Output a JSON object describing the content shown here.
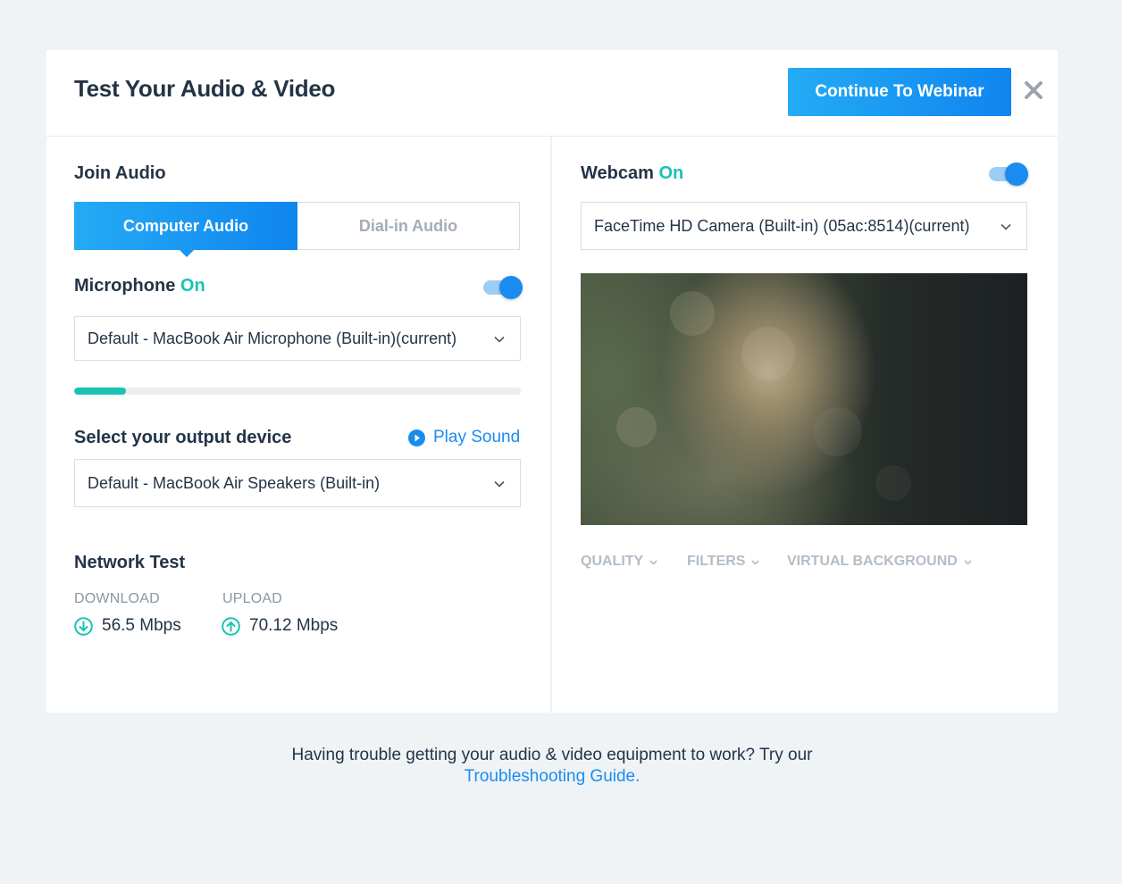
{
  "header": {
    "title": "Test Your Audio & Video",
    "continue_label": "Continue To Webinar",
    "close_icon": "close-icon"
  },
  "audio": {
    "section_title": "Join Audio",
    "tabs": [
      {
        "label": "Computer Audio",
        "active": true
      },
      {
        "label": "Dial-in Audio",
        "active": false
      }
    ],
    "microphone": {
      "label": "Microphone",
      "status": "On",
      "enabled": true,
      "device": "Default - MacBook Air Microphone (Built-in)(current)",
      "input_level_fraction": 0.115
    },
    "output": {
      "label": "Select your output device",
      "play_sound": "Play Sound",
      "device": "Default - MacBook Air Speakers (Built-in)"
    }
  },
  "network": {
    "title": "Network Test",
    "download_label": "DOWNLOAD",
    "download_value": "56.5 Mbps",
    "upload_label": "UPLOAD",
    "upload_value": "70.12 Mbps"
  },
  "webcam": {
    "label": "Webcam",
    "status": "On",
    "enabled": true,
    "device": "FaceTime HD Camera (Built-in) (05ac:8514)(current)",
    "options": [
      "QUALITY",
      "FILTERS",
      "VIRTUAL BACKGROUND"
    ]
  },
  "footer": {
    "text": "Having trouble getting your audio & video equipment to work? Try our",
    "link": "Troubleshooting Guide."
  },
  "colors": {
    "accent": "#1a8cf0",
    "on_status": "#19c3b3",
    "background": "#eff3f6"
  }
}
